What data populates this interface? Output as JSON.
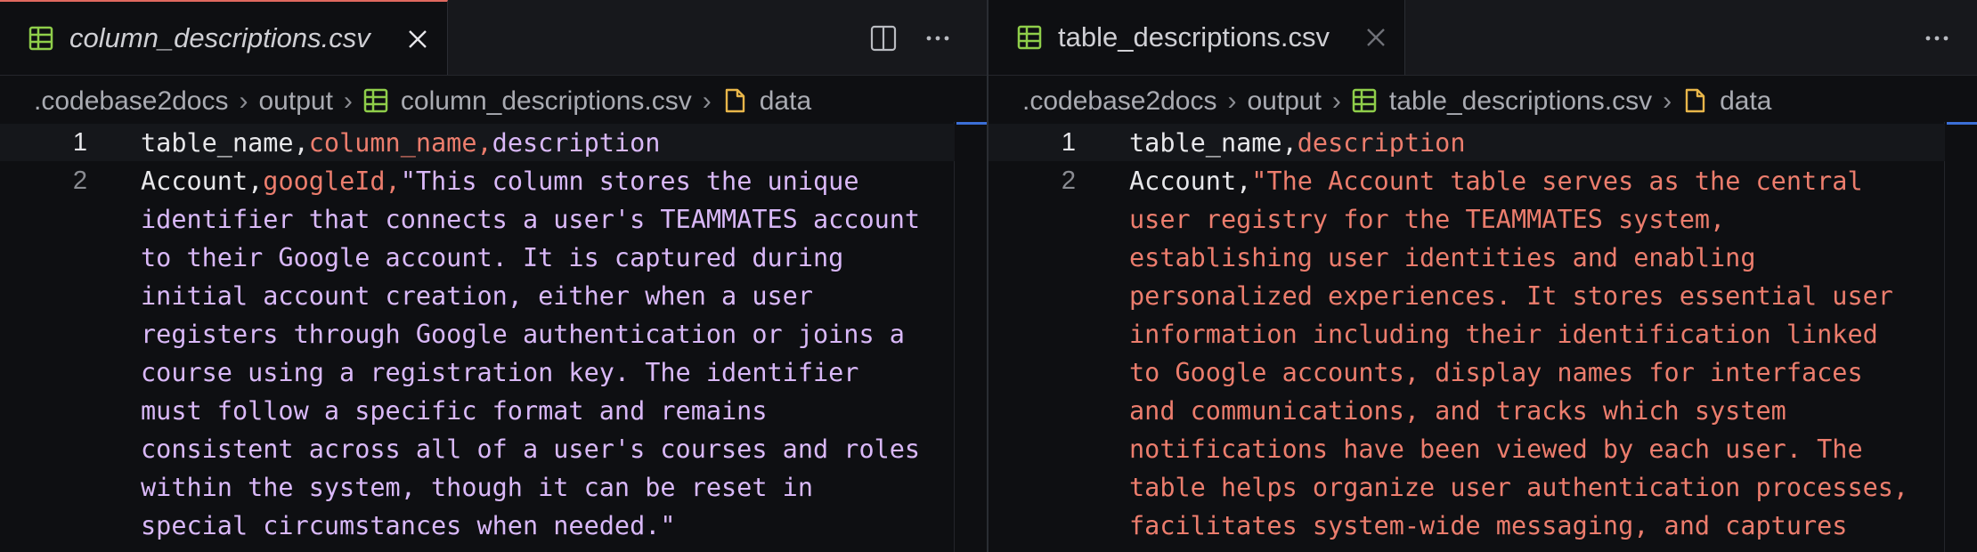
{
  "colors": {
    "background": "#0e0f12",
    "tabbar": "#17181c",
    "active_tab_border": "#e0695f",
    "csv_icon": "#8fce4a",
    "folder_icon": "#e8b64a",
    "col1": "#e7e7ea",
    "col2": "#ec7d6d",
    "col3": "#d9b8f8"
  },
  "left": {
    "tab": {
      "title": "column_descriptions.csv",
      "icon": "csv-table-icon",
      "close_icon": "close-icon"
    },
    "toolbar": {
      "split_icon": "split-editor-icon",
      "more_icon": "more-actions-icon"
    },
    "breadcrumb": [
      {
        "label": ".codebase2docs",
        "icon": ""
      },
      {
        "label": "output",
        "icon": ""
      },
      {
        "label": "column_descriptions.csv",
        "icon": "csv-table-icon"
      },
      {
        "label": "data",
        "icon": "file-icon"
      }
    ],
    "line_numbers": [
      "1",
      "2"
    ],
    "lines": {
      "header": {
        "col1": "table_name,",
        "col2": "column_name,",
        "col3": "description"
      },
      "row2": [
        {
          "col1": "Account,",
          "col2": "googleId,",
          "col3": "\"This column stores the unique"
        },
        {
          "col3": "identifier that connects a user's TEAMMATES account"
        },
        {
          "col3": "to their Google account. It is captured during"
        },
        {
          "col3": "initial account creation, either when a user"
        },
        {
          "col3": "registers through Google authentication or joins a"
        },
        {
          "col3": "course using a registration key. The identifier"
        },
        {
          "col3": "must follow a specific format and remains"
        },
        {
          "col3": "consistent across all of a user's courses and roles"
        },
        {
          "col3": "within the system, though it can be reset in"
        },
        {
          "col3": "special circumstances when needed.\""
        }
      ]
    }
  },
  "right": {
    "tab": {
      "title": "table_descriptions.csv",
      "icon": "csv-table-icon",
      "close_icon": "close-icon"
    },
    "toolbar": {
      "more_icon": "more-actions-icon"
    },
    "breadcrumb": [
      {
        "label": ".codebase2docs",
        "icon": ""
      },
      {
        "label": "output",
        "icon": ""
      },
      {
        "label": "table_descriptions.csv",
        "icon": "csv-table-icon"
      },
      {
        "label": "data",
        "icon": "file-icon"
      }
    ],
    "line_numbers": [
      "1",
      "2"
    ],
    "lines": {
      "header": {
        "col1": "table_name,",
        "col2": "description"
      },
      "row2": [
        {
          "col1": "Account,",
          "col2": "\"The Account table serves as the central"
        },
        {
          "col2": "user registry for the TEAMMATES system,"
        },
        {
          "col2": "establishing user identities and enabling"
        },
        {
          "col2": "personalized experiences. It stores essential user"
        },
        {
          "col2": "information including their identification linked"
        },
        {
          "col2": "to Google accounts, display names for interfaces"
        },
        {
          "col2": "and communications, and tracks which system"
        },
        {
          "col2": "notifications have been viewed by each user. The"
        },
        {
          "col2": "table helps organize user authentication processes,"
        },
        {
          "col2": "facilitates system-wide messaging, and captures"
        }
      ]
    }
  }
}
